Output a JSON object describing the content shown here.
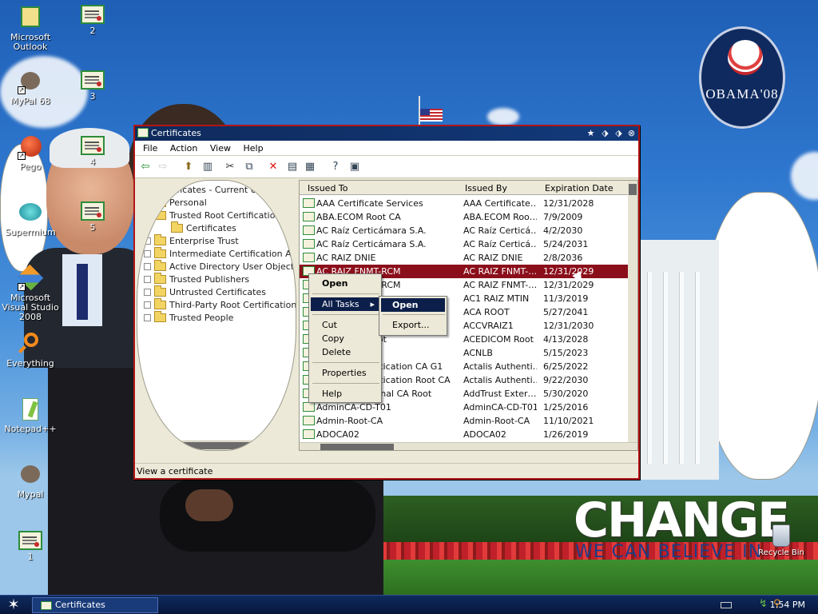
{
  "desktop": {
    "icons": [
      {
        "label": "Microsoft Outlook",
        "icon": "outlook-icon"
      },
      {
        "label": "MyPal 68",
        "icon": "raccoon-icon"
      },
      {
        "label": "Pego",
        "icon": "pego-icon"
      },
      {
        "label": "Supermium",
        "icon": "supermium-icon"
      },
      {
        "label": "Microsoft Visual Studio 2008",
        "icon": "visual-studio-icon"
      },
      {
        "label": "Everything",
        "icon": "everything-icon"
      },
      {
        "label": "Notepad++",
        "icon": "notepadpp-icon"
      },
      {
        "label": "Mypal",
        "icon": "raccoon-icon"
      },
      {
        "label": "1",
        "icon": "certificate-icon"
      },
      {
        "label": "2",
        "icon": "certificate-icon"
      },
      {
        "label": "3",
        "icon": "certificate-icon"
      },
      {
        "label": "4",
        "icon": "certificate-icon"
      },
      {
        "label": "5",
        "icon": "certificate-icon"
      }
    ],
    "recycle_bin": "Recycle Bin",
    "wallpaper": {
      "logo_text": "OBAMA'08",
      "slogan_main": "CHANGE",
      "slogan_sub": "WE CAN BELIEVE IN"
    }
  },
  "window": {
    "title": "Certificates",
    "menu": [
      "File",
      "Action",
      "View",
      "Help"
    ],
    "tree": {
      "root": "Certificates - Current User",
      "items": [
        "Personal",
        "Trusted Root Certification Authc",
        "Certificates",
        "Enterprise Trust",
        "Intermediate Certification Authc",
        "Active Directory User Object",
        "Trusted Publishers",
        "Untrusted Certificates",
        "Third-Party Root Certification Au",
        "Trusted People"
      ]
    },
    "columns": [
      "Issued To",
      "Issued By",
      "Expiration Date"
    ],
    "rows": [
      {
        "to": "AAA Certificate Services",
        "by": "AAA Certificate…",
        "exp": "12/31/2028"
      },
      {
        "to": "ABA.ECOM Root CA",
        "by": "ABA.ECOM Roo…",
        "exp": "7/9/2009"
      },
      {
        "to": "AC Raíz Certicámara S.A.",
        "by": "AC Raíz Certicá…",
        "exp": "4/2/2030"
      },
      {
        "to": "AC Raíz Certicámara S.A.",
        "by": "AC Raíz Certicá…",
        "exp": "5/24/2031"
      },
      {
        "to": "AC RAIZ DNIE",
        "by": "AC RAIZ DNIE",
        "exp": "2/8/2036"
      },
      {
        "to": "AC RAIZ FNMT-RCM",
        "by": "AC RAIZ FNMT-…",
        "exp": "12/31/2029"
      },
      {
        "to": "AC RAIZ FNMT-RCM",
        "by": "AC RAIZ FNMT-…",
        "exp": "12/31/2029"
      },
      {
        "to": "AC1 RAIZ MTIN",
        "by": "AC1 RAIZ MTIN",
        "exp": "11/3/2019"
      },
      {
        "to": "ACA ROOT",
        "by": "ACA ROOT",
        "exp": "5/27/2041"
      },
      {
        "to": "ACCVRAIZ1",
        "by": "ACCVRAIZ1",
        "exp": "12/31/2030"
      },
      {
        "to": "ACEDICOM Root",
        "by": "ACEDICOM Root",
        "exp": "4/13/2028"
      },
      {
        "to": "ACNLB",
        "by": "ACNLB",
        "exp": "5/15/2023"
      },
      {
        "to": "Actalis Authentication CA G1",
        "by": "Actalis Authenti…",
        "exp": "6/25/2022"
      },
      {
        "to": "Actalis Authentication Root CA",
        "by": "Actalis Authenti…",
        "exp": "9/22/2030"
      },
      {
        "to": "AddTrust External CA Root",
        "by": "AddTrust Exter…",
        "exp": "5/30/2020"
      },
      {
        "to": "AdminCA-CD-T01",
        "by": "AdminCA-CD-T01",
        "exp": "1/25/2016"
      },
      {
        "to": "Admin-Root-CA",
        "by": "Admin-Root-CA",
        "exp": "11/10/2021"
      },
      {
        "to": "ADOCA02",
        "by": "ADOCA02",
        "exp": "1/26/2019"
      }
    ],
    "selected_row": 5,
    "status": "View a certificate"
  },
  "context_menu": {
    "items": [
      "Open",
      "All Tasks",
      "Cut",
      "Copy",
      "Delete",
      "Properties",
      "Help"
    ]
  },
  "submenu": {
    "items": [
      "Open",
      "Export..."
    ]
  },
  "taskbar": {
    "start_icon": "star-icon",
    "task_label": "Certificates",
    "clock": "1:54 PM"
  },
  "colors": {
    "selection": "#8b0f1b",
    "menu_highlight": "#0c1f4a",
    "window_border": "#b21515",
    "taskbar": "#0e2a5e"
  }
}
